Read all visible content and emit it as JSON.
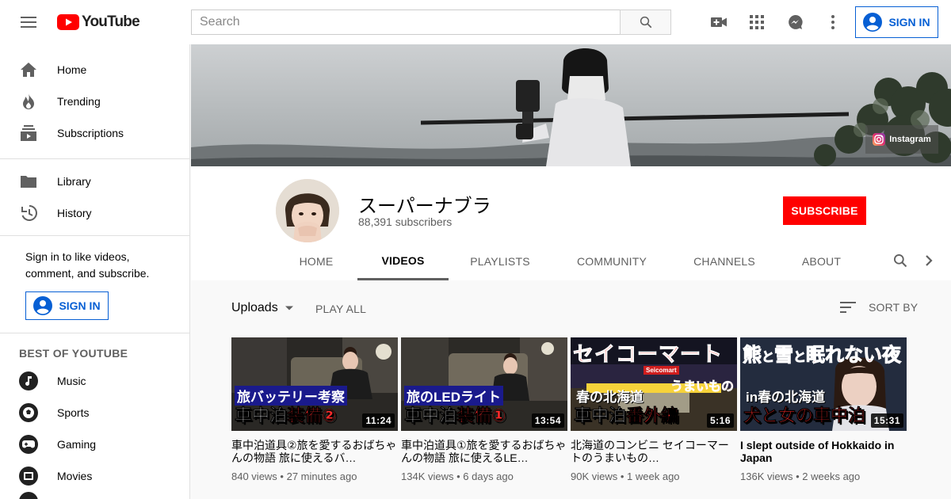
{
  "header": {
    "logo_text": "YouTube",
    "search_placeholder": "Search",
    "signin_label": "SIGN IN"
  },
  "sidebar": {
    "main": [
      {
        "label": "Home",
        "icon": "home-icon"
      },
      {
        "label": "Trending",
        "icon": "flame-icon"
      },
      {
        "label": "Subscriptions",
        "icon": "subscriptions-icon"
      }
    ],
    "library": [
      {
        "label": "Library",
        "icon": "folder-icon"
      },
      {
        "label": "History",
        "icon": "history-icon"
      }
    ],
    "signin_message": "Sign in to like videos, comment, and subscribe.",
    "signin_label": "SIGN IN",
    "best_title": "BEST OF YOUTUBE",
    "best": [
      {
        "label": "Music",
        "icon": "music-icon"
      },
      {
        "label": "Sports",
        "icon": "sports-icon"
      },
      {
        "label": "Gaming",
        "icon": "gaming-icon"
      },
      {
        "label": "Movies",
        "icon": "movies-icon"
      }
    ]
  },
  "banner": {
    "instagram_label": "Instagram"
  },
  "channel": {
    "name": "スーパーナブラ",
    "subscribers": "88,391 subscribers",
    "subscribe_label": "SUBSCRIBE",
    "tabs": [
      {
        "label": "HOME"
      },
      {
        "label": "VIDEOS",
        "active": true
      },
      {
        "label": "PLAYLISTS"
      },
      {
        "label": "COMMUNITY"
      },
      {
        "label": "CHANNELS"
      },
      {
        "label": "ABOUT"
      }
    ]
  },
  "content": {
    "uploads_label": "Uploads",
    "play_all_label": "PLAY ALL",
    "sort_label": "SORT BY"
  },
  "videos": [
    {
      "title": "車中泊道具②旅を愛するおばちゃんの物語 旅に使えるバ…",
      "views": "840 views",
      "age": "27 minutes ago",
      "duration": "11:24",
      "thumb_line1": "旅バッテリー考察",
      "thumb_line2a": "車中泊",
      "thumb_line2b": "装備②"
    },
    {
      "title": "車中泊道具①旅を愛するおばちゃんの物語 旅に使えるLE…",
      "views": "134K views",
      "age": "6 days ago",
      "duration": "13:54",
      "thumb_line1": "旅のLEDライト",
      "thumb_line2a": "車中泊",
      "thumb_line2b": "装備①"
    },
    {
      "title": "北海道のコンビニ セイコーマートのうまいもの…",
      "views": "90K views",
      "age": "1 week ago",
      "duration": "5:16",
      "thumb_top": "セイコーマート",
      "thumb_sub": "うまいもの",
      "thumb_line1": "春の北海道",
      "thumb_line2a": "車中泊",
      "thumb_line2b": "番外編",
      "store_sign": "Seicomart"
    },
    {
      "title": "I slept outside of Hokkaido in Japan",
      "views": "136K views",
      "age": "2 weeks ago",
      "duration": "15:31",
      "thumb_top_a": "熊",
      "thumb_top_b": "と",
      "thumb_top_c": "雪",
      "thumb_top_d": "と",
      "thumb_top_e": "眠れない夜",
      "thumb_line1": "in春の北海道",
      "thumb_line2a": "犬と女の",
      "thumb_line2b": "車中泊"
    }
  ],
  "colors": {
    "accent_blue": "#065fd4",
    "subscribe_red": "#ff0000",
    "text_secondary": "#606060"
  }
}
